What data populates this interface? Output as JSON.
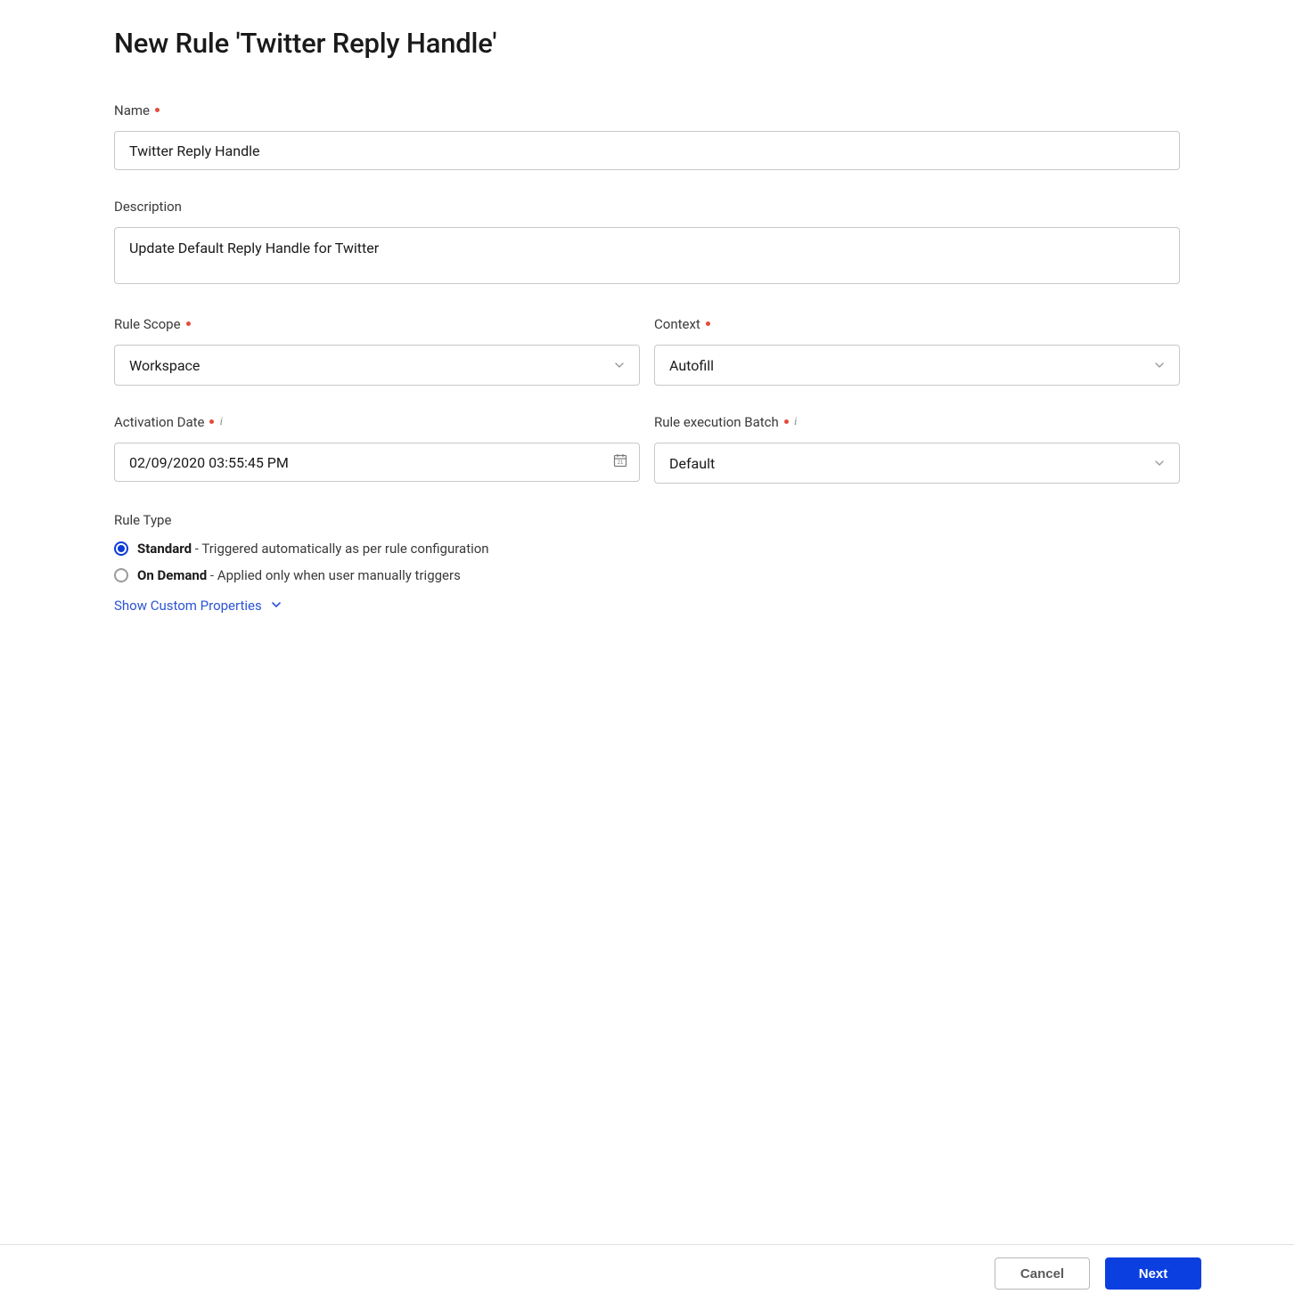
{
  "page": {
    "title": "New Rule 'Twitter Reply Handle'"
  },
  "fields": {
    "name": {
      "label": "Name",
      "required": true,
      "value": "Twitter Reply Handle"
    },
    "description": {
      "label": "Description",
      "required": false,
      "value": "Update Default Reply Handle for Twitter"
    },
    "ruleScope": {
      "label": "Rule Scope",
      "required": true,
      "value": "Workspace"
    },
    "context": {
      "label": "Context",
      "required": true,
      "value": "Autofill"
    },
    "activationDate": {
      "label": "Activation Date",
      "required": true,
      "info": true,
      "value": "02/09/2020 03:55:45 PM"
    },
    "executionBatch": {
      "label": "Rule execution Batch",
      "required": true,
      "info": true,
      "value": "Default"
    }
  },
  "ruleType": {
    "label": "Rule Type",
    "options": {
      "standard": {
        "title": "Standard",
        "desc": " - Triggered automatically as per rule configuration",
        "selected": true
      },
      "onDemand": {
        "title": "On Demand",
        "desc": " - Applied only when user manually triggers",
        "selected": false
      }
    }
  },
  "links": {
    "customProps": "Show Custom Properties"
  },
  "footer": {
    "cancel": "Cancel",
    "next": "Next"
  }
}
